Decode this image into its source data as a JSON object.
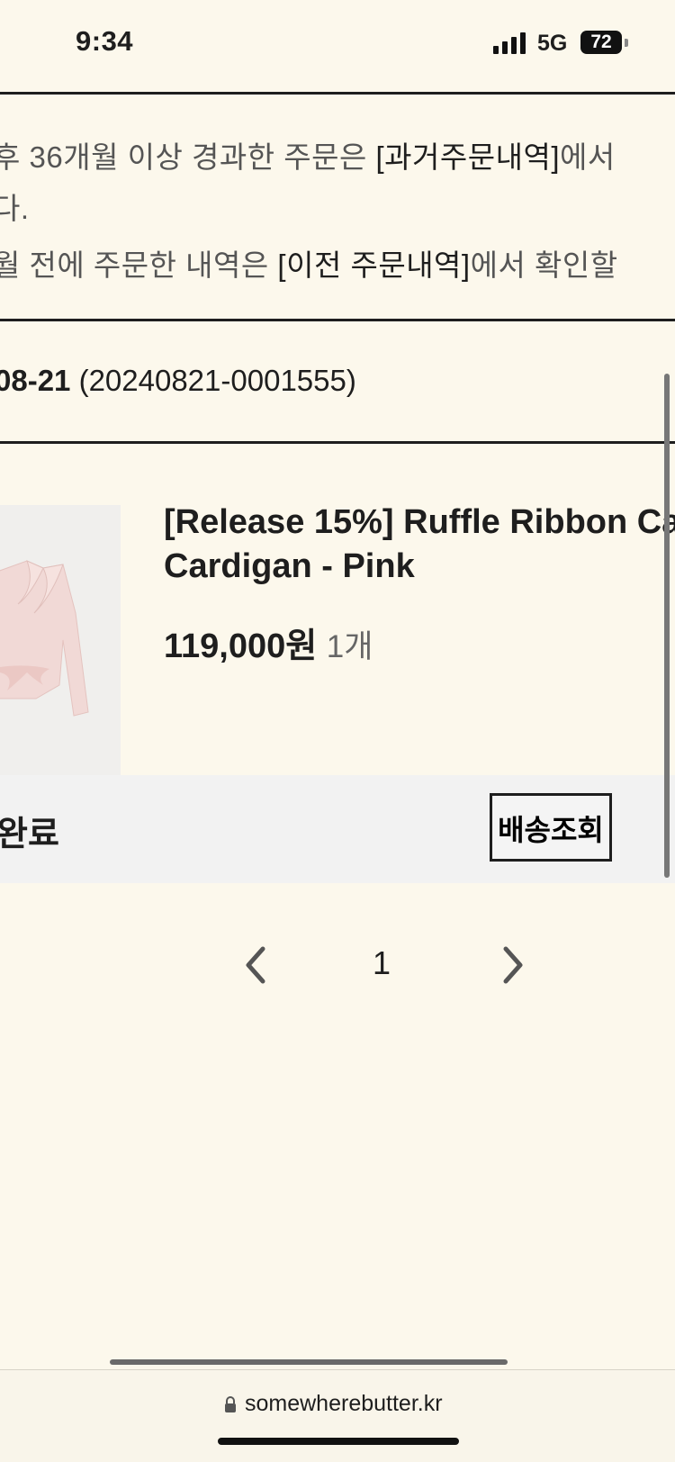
{
  "status_bar": {
    "time": "9:34",
    "network": "5G",
    "battery": "72"
  },
  "notice": {
    "line1_pre": "후 36개월 이상 경과한 주문은 ",
    "line1_link": "[과거주문내역]",
    "line1_post": "에서",
    "line2": "다.",
    "line3_pre": "월 전에 주문한 내역은 ",
    "line3_link": "[이전 주문내역]",
    "line3_post": "에서 확인할"
  },
  "order": {
    "date": "08-21",
    "number": "(20240821-0001555)"
  },
  "product": {
    "title_line1": "[Release 15%] Ruffle Ribbon Ca",
    "title_line2": "Cardigan - Pink",
    "price": "119,000원",
    "quantity": "1개"
  },
  "shipment": {
    "status": "완료",
    "track_button": "배송조회"
  },
  "pagination": {
    "current_page": "1"
  },
  "browser": {
    "url": "somewherebutter.kr"
  }
}
